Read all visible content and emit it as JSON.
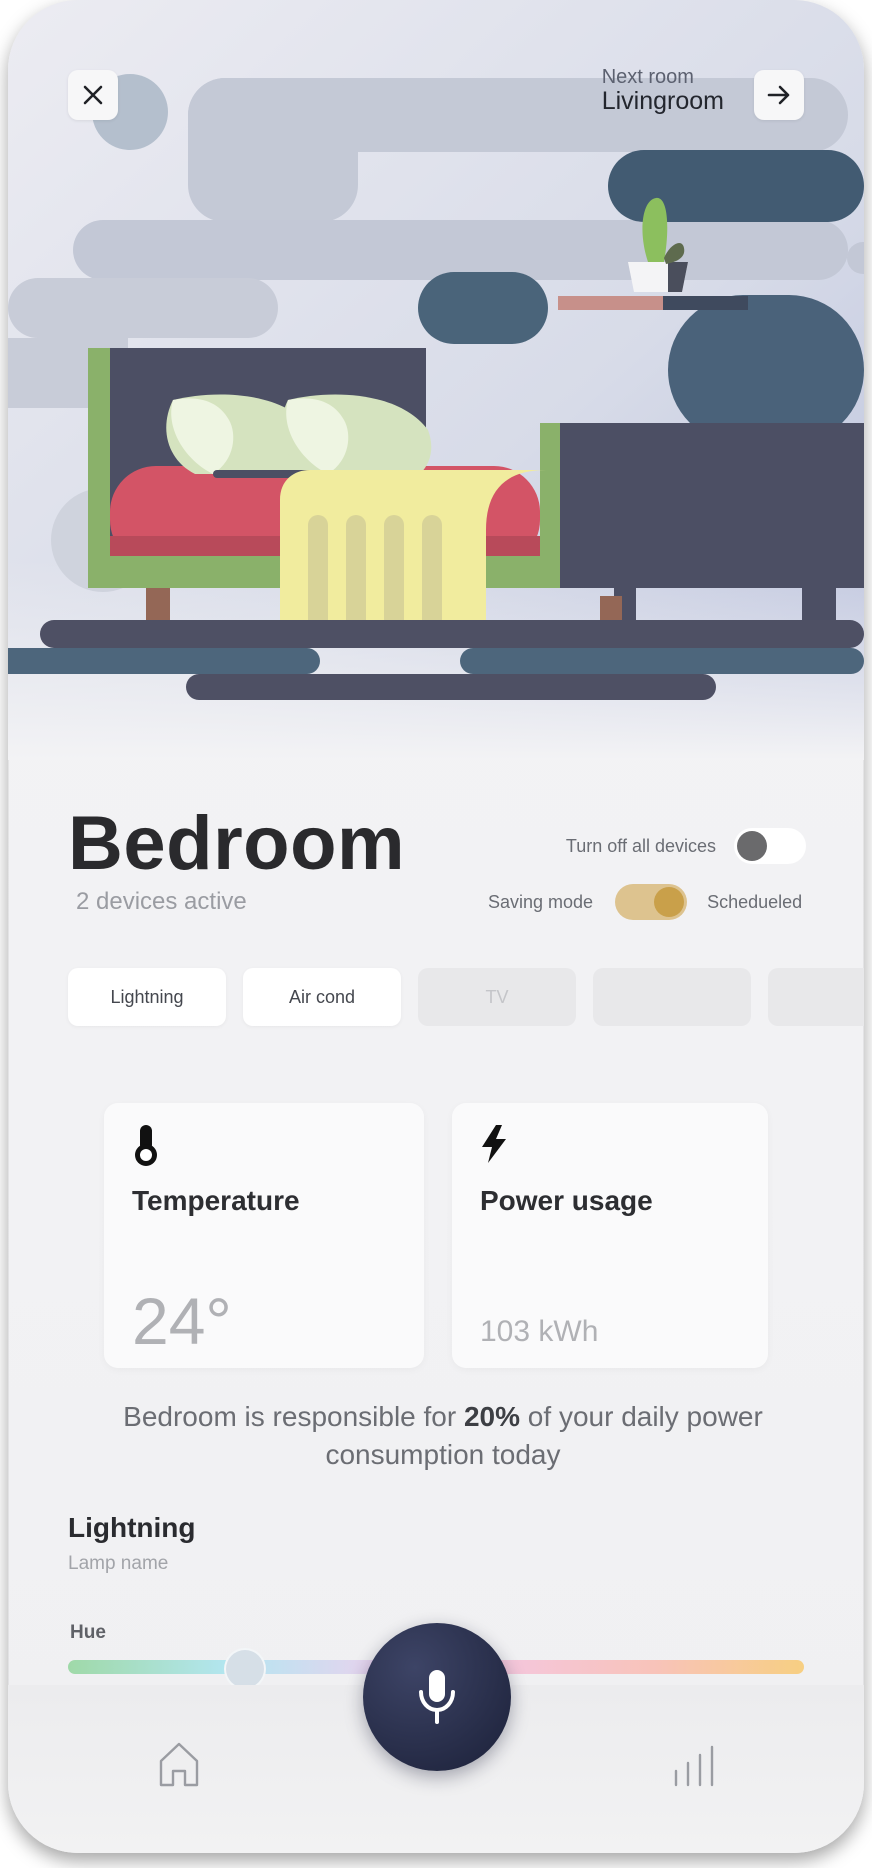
{
  "header": {
    "next_room_label": "Next room",
    "next_room_value": "Livingroom"
  },
  "room": {
    "title": "Bedroom",
    "subtitle": "2 devices active"
  },
  "toggles": {
    "turn_off_label": "Turn off all devices",
    "turn_off_on": false,
    "saving_label": "Saving mode",
    "saving_on": true,
    "scheduled_label": "Schedueled"
  },
  "chips": [
    {
      "label": "Lightning",
      "active": true
    },
    {
      "label": "Air cond",
      "active": true
    },
    {
      "label": "TV",
      "active": false
    },
    {
      "label": "",
      "active": false
    },
    {
      "label": "",
      "active": false
    }
  ],
  "cards": {
    "temperature": {
      "title": "Temperature",
      "value": "24°"
    },
    "power": {
      "title": "Power usage",
      "value": "103 kWh"
    }
  },
  "summary": {
    "before": "Bedroom is responsible for ",
    "percent": "20%",
    "after": " of your daily power consumption today"
  },
  "lighting": {
    "title": "Lightning",
    "subtitle": "Lamp name",
    "hue_label": "Hue",
    "hue_value": 0.24
  },
  "icons": [
    "close-icon",
    "arrow-right-icon",
    "thermometer-icon",
    "lightning-icon",
    "microphone-icon",
    "home-icon",
    "stats-icon"
  ],
  "colors": {
    "accent_gold": "#c9a04a",
    "mic_dark": "#1b2038"
  }
}
